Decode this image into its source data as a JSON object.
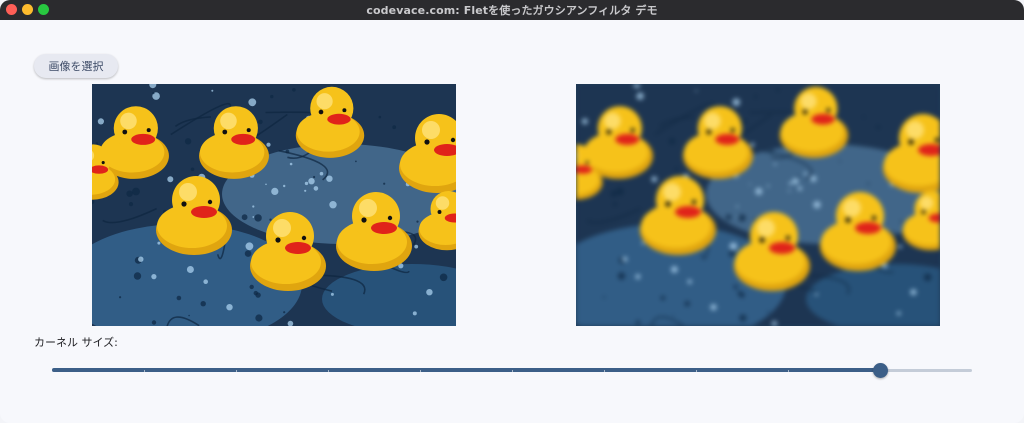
{
  "window": {
    "title": "codevace.com: Fletを使ったガウシアンフィルタ デモ"
  },
  "toolbar": {
    "select_image_label": "画像を選択"
  },
  "images": {
    "original": {
      "subject": "rubber ducks floating on blue paint-splattered water"
    },
    "filtered": {
      "subject": "rubber ducks floating on blue paint-splattered water (gaussian blurred)"
    }
  },
  "kernel": {
    "label": "カーネル サイズ:",
    "slider_fraction": 0.9,
    "divisions": 10
  },
  "colors": {
    "accent": "#3c5f88",
    "duck_yellow": "#f6c21a",
    "beak_red": "#e0231a",
    "water_blue": "#2a5f8f"
  }
}
